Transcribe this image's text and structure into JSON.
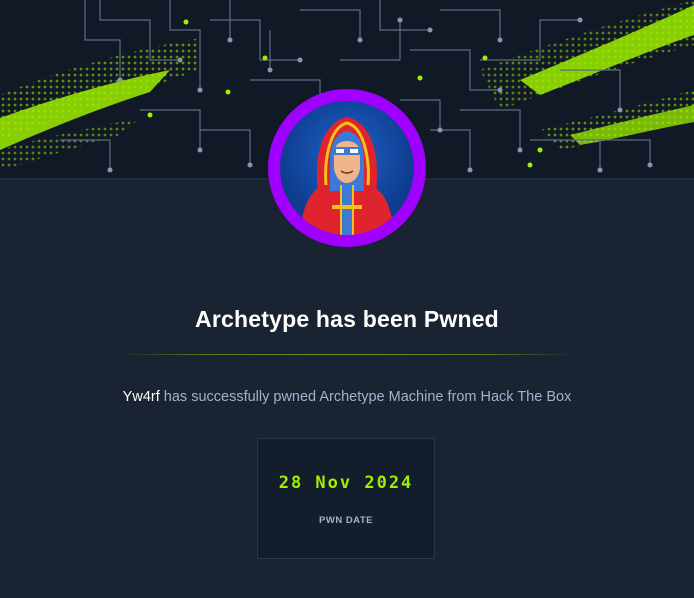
{
  "machine": {
    "title": "Archetype has been Pwned",
    "user": "Yw4rf",
    "message": "has successfully pwned Archetype Machine from Hack The Box"
  },
  "pwn": {
    "date": "28 Nov 2024",
    "date_label": "PWN DATE"
  },
  "colors": {
    "background": "#1a2332",
    "accent": "#9fef00",
    "avatar_ring": "#9f00ff",
    "text_muted": "#a4b1cd"
  },
  "icons": {
    "avatar": "hooded-figure-avatar-icon",
    "banner": "circuit-board-banner"
  }
}
